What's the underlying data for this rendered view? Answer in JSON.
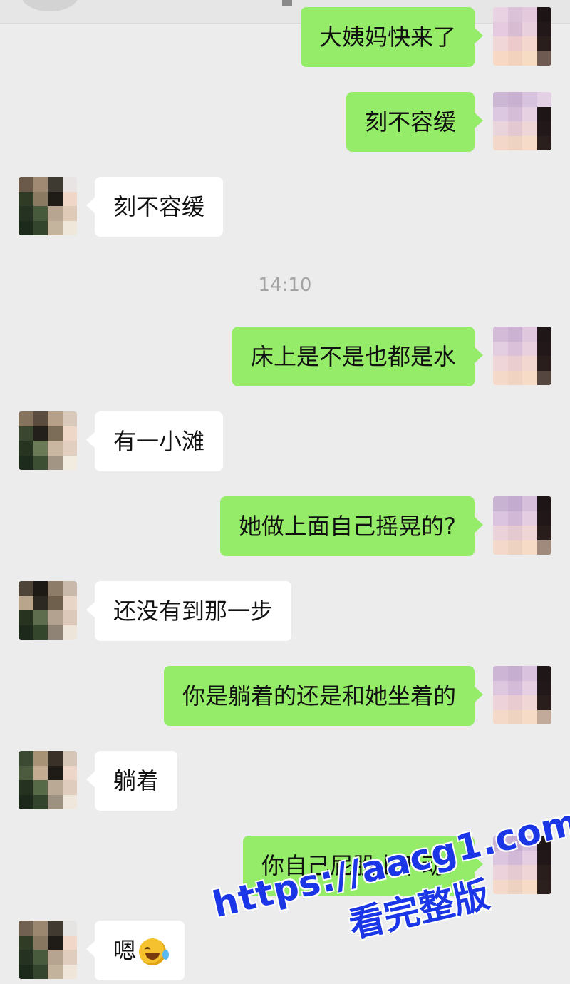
{
  "timestamp": "14:10",
  "messages": [
    {
      "side": "me",
      "text": "大姨妈快来了"
    },
    {
      "side": "me",
      "text": "刻不容缓"
    },
    {
      "side": "them",
      "text": "刻不容缓"
    },
    {
      "side": "me",
      "text": "床上是不是也都是水"
    },
    {
      "side": "them",
      "text": "有一小滩"
    },
    {
      "side": "me",
      "text": "她做上面自己摇晃的?"
    },
    {
      "side": "them",
      "text": "还没有到那一步"
    },
    {
      "side": "me",
      "text": "你是躺着的还是和她坐着的"
    },
    {
      "side": "them",
      "text": "躺着"
    },
    {
      "side": "me",
      "text": "你自己屁股上下动?"
    },
    {
      "side": "them",
      "text": "嗯",
      "emoji": "laughing-tears-icon"
    }
  ],
  "watermark": {
    "url": "https://aacg1.com",
    "subtitle": "看完整版",
    "color": "#1a36e6"
  },
  "colors": {
    "background": "#ececec",
    "my_bubble": "#95ec69",
    "their_bubble": "#ffffff",
    "timestamp_text": "#a3a3a3"
  }
}
